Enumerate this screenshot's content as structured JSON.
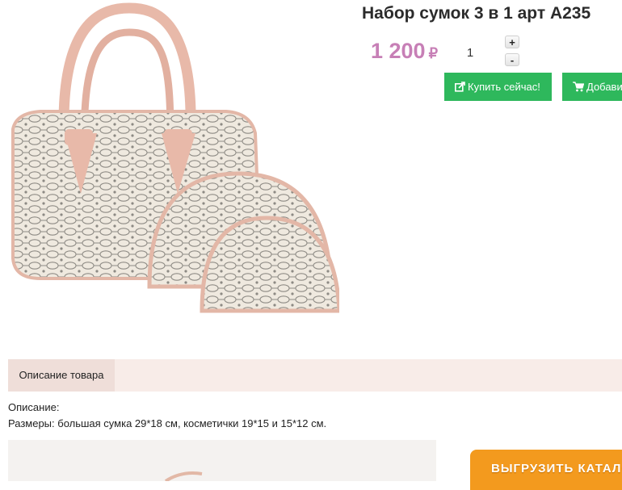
{
  "product": {
    "title": "Набор сумок 3 в 1 арт A235",
    "price": "1 200",
    "currency": "₽",
    "quantity": "1"
  },
  "quantity_controls": {
    "plus": "+",
    "minus": "-"
  },
  "actions": {
    "buy_now": "Купить сейчас!",
    "add_to_cart": "Добави"
  },
  "tabs": [
    {
      "label": "Описание товара"
    }
  ],
  "description": {
    "heading": "Описание:",
    "sizes": "Размеры: большая сумка 29*18 см, косметички 19*15 и 15*12 см."
  },
  "export_button": "ВЫГРУЗИТЬ КАТАЛО",
  "colors": {
    "price": "#c77fb6",
    "buttons": "#2eb85c",
    "tab_bar": "#f8ece8",
    "active_tab": "#efded9",
    "export": "#f39a1e"
  },
  "icons": {
    "buy_now": "external-link-icon",
    "add_to_cart": "cart-icon"
  }
}
